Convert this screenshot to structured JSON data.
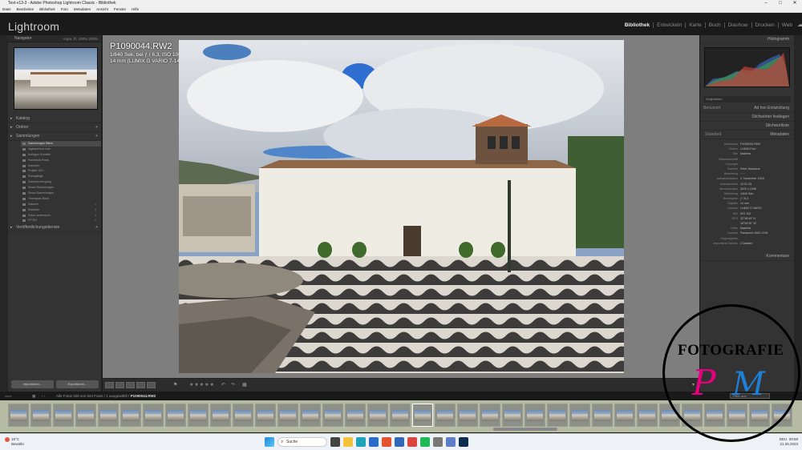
{
  "window": {
    "title": "Test-v13-3 - Adobe Photoshop Lightroom Classic - Bibliothek"
  },
  "menu": [
    "Datei",
    "Bearbeiten",
    "Bibliothek",
    "Foto",
    "Metadaten",
    "Ansicht",
    "Fenster",
    "Hilfe"
  ],
  "app": {
    "logo": "Lightroom"
  },
  "modules": [
    "Bibliothek",
    "Entwickeln",
    "Karte",
    "Buch",
    "Diashow",
    "Drucken",
    "Web"
  ],
  "left_panel": {
    "navigator": {
      "title": "Navigator",
      "zoom": "Anpa.  Fl.  100%  200%"
    },
    "sections": [
      "Katalog",
      "Ordner",
      "Sammlungen"
    ],
    "collections": [
      {
        "label": "Sammlungen filtern",
        "count": ""
      },
      {
        "label": "digikamfotos.com",
        "count": ""
      },
      {
        "label": "Auflagen Knoeller",
        "count": ""
      },
      {
        "label": "Facebook-Posts",
        "count": ""
      },
      {
        "label": "Kalender",
        "count": ""
      },
      {
        "label": "Projekt 120 I",
        "count": ""
      },
      {
        "label": "Rundgänge",
        "count": ""
      },
      {
        "label": "Sonnenuntergang",
        "count": ""
      },
      {
        "label": "Smart-Sammlungen",
        "count": ""
      },
      {
        "label": "Smart-Sammlungen",
        "count": ""
      },
      {
        "label": "Timelapse-Rose",
        "count": ""
      },
      {
        "label": "Diaserie",
        "count": "1"
      },
      {
        "label": "Entwürfe",
        "count": "3"
      },
      {
        "label": "Fotos verbessern",
        "count": "4"
      },
      {
        "label": "FP-RO",
        "count": "2"
      }
    ],
    "publish_title": "Veröffentlichungsdienste",
    "import_label": "Importieren...",
    "export_label": "Exportieren..."
  },
  "photo": {
    "filename": "P1090044.RW2",
    "exposure": "1/640 Sek. bei ƒ / 6,3, ISO 100",
    "lens": "14 mm (LUMIX G VARIO 7-14/F4.0)"
  },
  "toolbar": {
    "stars": "★★★★★"
  },
  "filmbar": {
    "crumb": "Alle Fotos   326 von 944 Fotos / 1 ausgewählt /",
    "filename": "P1090044.RW2",
    "filter_label": "Filter aus"
  },
  "right_panel": {
    "histogram_title": "Histogramm",
    "original_label": "Originalfoto",
    "quick_develop": "Ad hoc-Entwicklung",
    "quick_develop_preset": "Benutzert",
    "keywords": "Stichwörter festlegen",
    "keyword_list": "Stichwortliste",
    "metadata_title": "Metadaten",
    "metadata_preset": "Standard",
    "metadata_rows": [
      {
        "k": "Dateiname",
        "v": "P1090044.RW2"
      },
      {
        "k": "Ordner",
        "v": "LUMIX-Foto"
      },
      {
        "k": "Titel",
        "v": "Madeira"
      },
      {
        "k": "Bildunterschrift",
        "v": ""
      },
      {
        "k": "Copyright",
        "v": ""
      },
      {
        "k": "Ersteller",
        "v": "Peter Marianne"
      },
      {
        "k": "Bewertung",
        "v": "·····"
      },
      {
        "k": "Aufnahmedatum",
        "v": "1. November 2018"
      },
      {
        "k": "Aufnahmezeit",
        "v": "12:31:35"
      },
      {
        "k": "Abmessungen",
        "v": "3020 x 2496"
      },
      {
        "k": "Belichtung",
        "v": "1/640 Sek."
      },
      {
        "k": "Brennweite",
        "v": "ƒ / 6,3"
      },
      {
        "k": "Objektiv",
        "v": "14 mm"
      },
      {
        "k": "Kamera",
        "v": "LUMIX G VARIO"
      },
      {
        "k": "ISO",
        "v": "ISO 100"
      },
      {
        "k": "GPS",
        "v": "32°38'49\" N"
      },
      {
        "k": "",
        "v": "16°54'30\" W"
      },
      {
        "k": "Höhe",
        "v": "Madeira"
      },
      {
        "k": "Kamera",
        "v": "Panasonic DMC-GX8"
      },
      {
        "k": "Originalgröße",
        "v": ""
      },
      {
        "k": "Importierte Dateien",
        "v": "2 Dateien"
      }
    ],
    "comments": "Kommentare",
    "sync_meta": "Synchronisieren",
    "sync_set": "Einst. synchr."
  },
  "taskbar": {
    "weather_temp": "19°C",
    "weather_desc": "Bewölkt",
    "search": "Suche",
    "lang": "DEU",
    "time": "09:58",
    "date": "21.05.2023"
  },
  "watermark": {
    "text": "FOTOGRAFIE",
    "mark_p": "P",
    "mark_m": "M"
  },
  "colors": {
    "panel": "#333333",
    "center_bg": "#7e7e7e",
    "filmstrip": "#b8bba4",
    "watermark_pink": "#e6007e",
    "watermark_blue": "#1d7fd6"
  }
}
